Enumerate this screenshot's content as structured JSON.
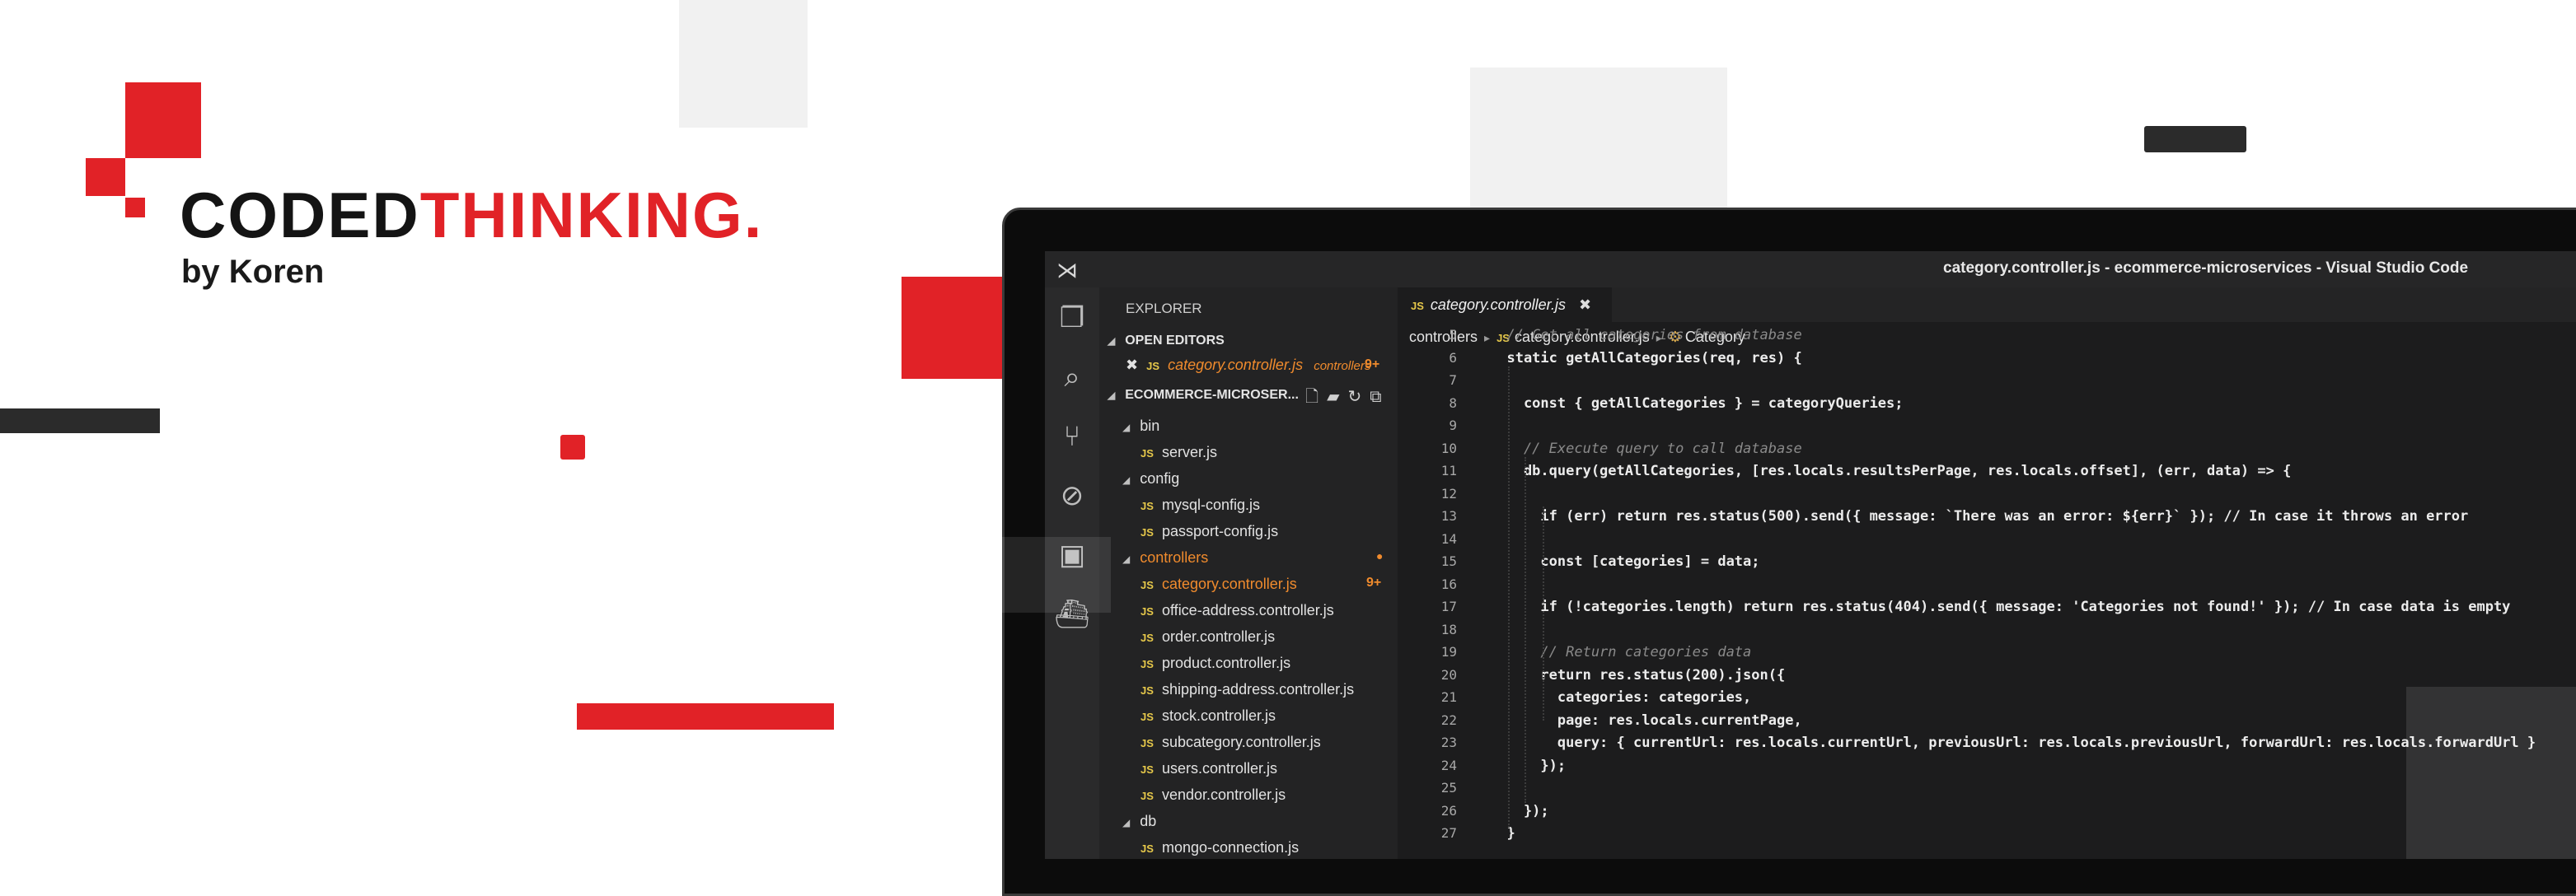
{
  "logo": {
    "word1": "CODED",
    "word2": "THINKING.",
    "byline": "by Koren"
  },
  "editor": {
    "window_title": "category.controller.js - ecommerce-microservices - Visual Studio Code",
    "explorer_label": "EXPLORER",
    "open_editors_label": "OPEN EDITORS",
    "open_file": {
      "icon": "JS",
      "name": "category.controller.js",
      "folder": "controllers",
      "badge": "9+"
    },
    "project_label": "ECOMMERCE-MICROSER...",
    "tree": [
      {
        "label": "bin",
        "type": "folder"
      },
      {
        "label": "server.js",
        "type": "file"
      },
      {
        "label": "config",
        "type": "folder"
      },
      {
        "label": "mysql-config.js",
        "type": "file"
      },
      {
        "label": "passport-config.js",
        "type": "file"
      },
      {
        "label": "controllers",
        "type": "folder"
      },
      {
        "label": "category.controller.js",
        "type": "file",
        "badge": "9+"
      },
      {
        "label": "office-address.controller.js",
        "type": "file"
      },
      {
        "label": "order.controller.js",
        "type": "file"
      },
      {
        "label": "product.controller.js",
        "type": "file"
      },
      {
        "label": "shipping-address.controller.js",
        "type": "file"
      },
      {
        "label": "stock.controller.js",
        "type": "file"
      },
      {
        "label": "subcategory.controller.js",
        "type": "file"
      },
      {
        "label": "users.controller.js",
        "type": "file"
      },
      {
        "label": "vendor.controller.js",
        "type": "file"
      },
      {
        "label": "db",
        "type": "folder"
      },
      {
        "label": "mongo-connection.js",
        "type": "file"
      }
    ],
    "tab": {
      "icon": "JS",
      "label": "category.controller.js",
      "close": "✖"
    },
    "breadcrumbs": {
      "folder": "controllers",
      "file": "category.controller.js",
      "symbol": "Category"
    },
    "code_lines": [
      {
        "num": "5",
        "text": "  // Get all categories from database"
      },
      {
        "num": "6",
        "text": "  static getAllCategories(req, res) {"
      },
      {
        "num": "7",
        "text": ""
      },
      {
        "num": "8",
        "text": "    const { getAllCategories } = categoryQueries;"
      },
      {
        "num": "9",
        "text": ""
      },
      {
        "num": "10",
        "text": "    // Execute query to call database"
      },
      {
        "num": "11",
        "text": "    db.query(getAllCategories, [res.locals.resultsPerPage, res.locals.offset], (err, data) => {"
      },
      {
        "num": "12",
        "text": ""
      },
      {
        "num": "13",
        "text": "      if (err) return res.status(500).send({ message: `There was an error: ${err}` }); // In case it throws an error"
      },
      {
        "num": "14",
        "text": ""
      },
      {
        "num": "15",
        "text": "      const [categories] = data;"
      },
      {
        "num": "16",
        "text": ""
      },
      {
        "num": "17",
        "text": "      if (!categories.length) return res.status(404).send({ message: 'Categories not found!' }); // In case data is empty"
      },
      {
        "num": "18",
        "text": ""
      },
      {
        "num": "19",
        "text": "      // Return categories data"
      },
      {
        "num": "20",
        "text": "      return res.status(200).json({"
      },
      {
        "num": "21",
        "text": "        categories: categories,"
      },
      {
        "num": "22",
        "text": "        page: res.locals.currentPage,"
      },
      {
        "num": "23",
        "text": "        query: { currentUrl: res.locals.currentUrl, previousUrl: res.locals.previousUrl, forwardUrl: res.locals.forwardUrl }"
      },
      {
        "num": "24",
        "text": "      });"
      },
      {
        "num": "25",
        "text": ""
      },
      {
        "num": "26",
        "text": "    });"
      },
      {
        "num": "27",
        "text": "  }"
      }
    ]
  },
  "colors": {
    "accent_red": "#e12227",
    "dark": "#141414",
    "badge_orange": "#f08b2d",
    "js_yellow": "#e6c84a"
  }
}
